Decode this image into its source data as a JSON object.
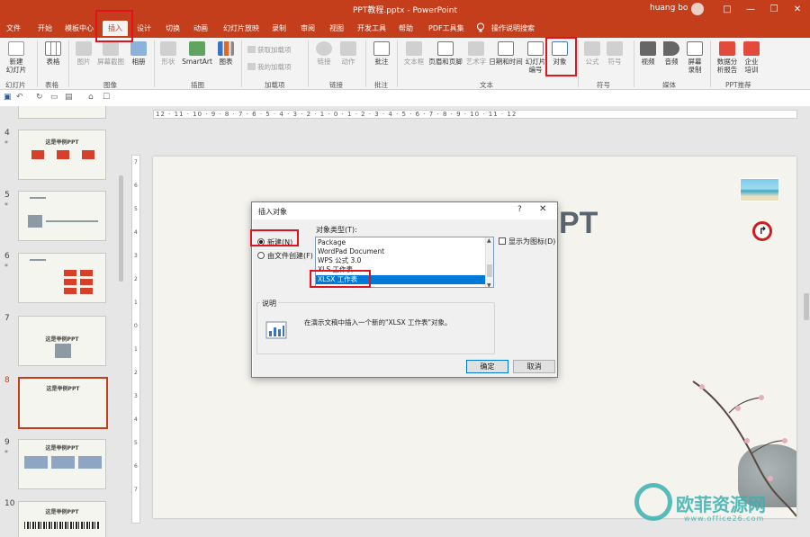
{
  "window": {
    "title": "PPT教程.pptx  -  PowerPoint",
    "user": "huang bo",
    "controls": [
      "□",
      "—",
      "❐",
      "✕"
    ]
  },
  "tabs": [
    "文件",
    "开始",
    "模板中心",
    "插入",
    "设计",
    "切换",
    "动画",
    "幻灯片放映",
    "录制",
    "审阅",
    "视图",
    "开发工具",
    "帮助",
    "PDF工具集",
    "操作说明搜索"
  ],
  "ribbon": {
    "new_slide": "新建\n幻灯片",
    "table": "表格",
    "image": "图片",
    "screenshot": "屏幕截图",
    "album": "相册",
    "shapes": "形状",
    "smartart": "SmartArt",
    "chart": "图表",
    "get_addins": "获取加载项",
    "my_addins": "我的加载项",
    "link": "链接",
    "action": "动作",
    "comment": "批注",
    "textbox": "文本框",
    "header_footer": "页眉和页脚",
    "wordart": "艺术字",
    "datetime": "日期和时间",
    "slide_number": "幻灯片\n编号",
    "object": "对象",
    "equation": "公式",
    "symbol": "符号",
    "video": "视频",
    "audio": "音频",
    "screen_record": "屏幕\n录制",
    "data_report": "数据分\n析报告",
    "training": "企业\n培训",
    "groups": [
      "幻灯片",
      "表格",
      "图像",
      "插图",
      "加载项",
      "链接",
      "批注",
      "文本",
      "符号",
      "媒体",
      "PPT推荐"
    ]
  },
  "ruler": {
    "h": "12 · 11 · 10 · 9 · 8 · 7 · 6 · 5 · 4 · 3 · 2 · 1 · 0 · 1 · 2 · 3 · 4 · 5 · 6 · 7 · 8 · 9 · 10 · 11 · 12",
    "v": [
      "7",
      "6",
      "5",
      "4",
      "3",
      "2",
      "1",
      "0",
      "1",
      "2",
      "3",
      "4",
      "5",
      "6",
      "7"
    ]
  },
  "thumbnails": [
    {
      "num": "4",
      "star": "*",
      "title": "这是举例PPT"
    },
    {
      "num": "5",
      "star": "*",
      "title": ""
    },
    {
      "num": "6",
      "star": "*",
      "title": ""
    },
    {
      "num": "7",
      "star": "",
      "title": "这是举例PPT"
    },
    {
      "num": "8",
      "star": "",
      "title": "这是举例PPT"
    },
    {
      "num": "9",
      "star": "*",
      "title": "这是举例PPT"
    },
    {
      "num": "10",
      "star": "",
      "title": "这是举例PPT"
    }
  ],
  "slide": {
    "title_visible": "PT"
  },
  "dialog": {
    "title": "插入对象",
    "help": "?",
    "close": "✕",
    "radio_new": "新建(N)",
    "radio_from_file": "由文件创建(F)",
    "object_type_label": "对象类型(T):",
    "list_items": [
      "Package",
      "WordPad Document",
      "WPS 公式 3.0",
      "XLS 工作表",
      "XLSX 工作表"
    ],
    "selected_item": "XLSX 工作表",
    "show_as_icon": "显示为图标(D)",
    "desc_label": "说明",
    "desc_text": "在演示文稿中插入一个新的\"XLSX 工作表\"对象。",
    "ok": "确定",
    "cancel": "取消"
  },
  "watermark": {
    "text": "欧菲资源网",
    "url": "www.office26.com"
  },
  "colors": {
    "accent": "#c43e1c",
    "highlight": "#e0141e",
    "selection": "#0078d7"
  }
}
